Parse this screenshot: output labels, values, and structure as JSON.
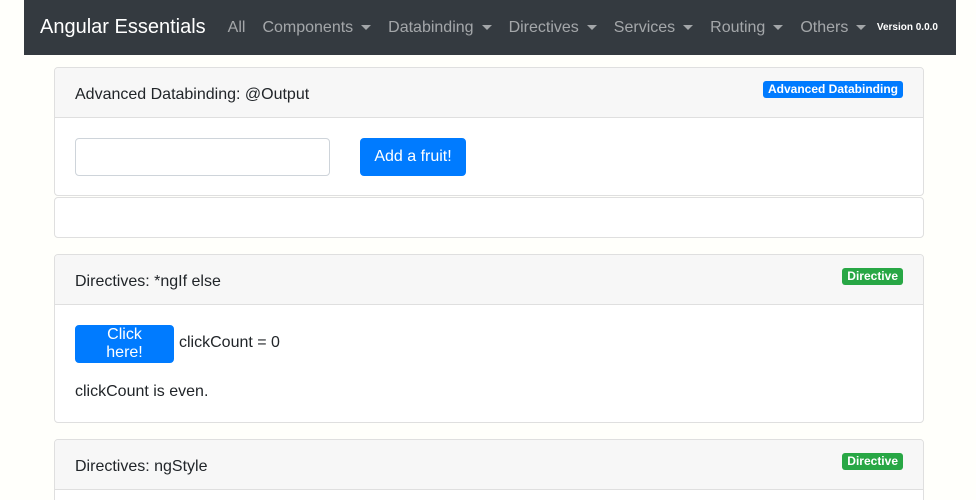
{
  "navbar": {
    "brand": "Angular Essentials",
    "items": [
      {
        "label": "All",
        "dropdown": false
      },
      {
        "label": "Components",
        "dropdown": true
      },
      {
        "label": "Databinding",
        "dropdown": true
      },
      {
        "label": "Directives",
        "dropdown": true
      },
      {
        "label": "Services",
        "dropdown": true
      },
      {
        "label": "Routing",
        "dropdown": true
      },
      {
        "label": "Others",
        "dropdown": true
      }
    ],
    "version": "Version 0.0.0"
  },
  "cards": [
    {
      "title": "Advanced Databinding: @Output",
      "badge": "Advanced Databinding",
      "input_value": "",
      "button_label": "Add a fruit!"
    },
    {
      "title": "Directives: *ngIf else",
      "badge": "Directive",
      "button_label": "Click here!",
      "click_count_text": "clickCount = 0",
      "parity_text": "clickCount is even."
    },
    {
      "title": "Directives: ngStyle",
      "badge": "Directive"
    }
  ],
  "colors": {
    "navbar_bg": "#343a40",
    "primary": "#007bff",
    "success": "#28a745"
  }
}
